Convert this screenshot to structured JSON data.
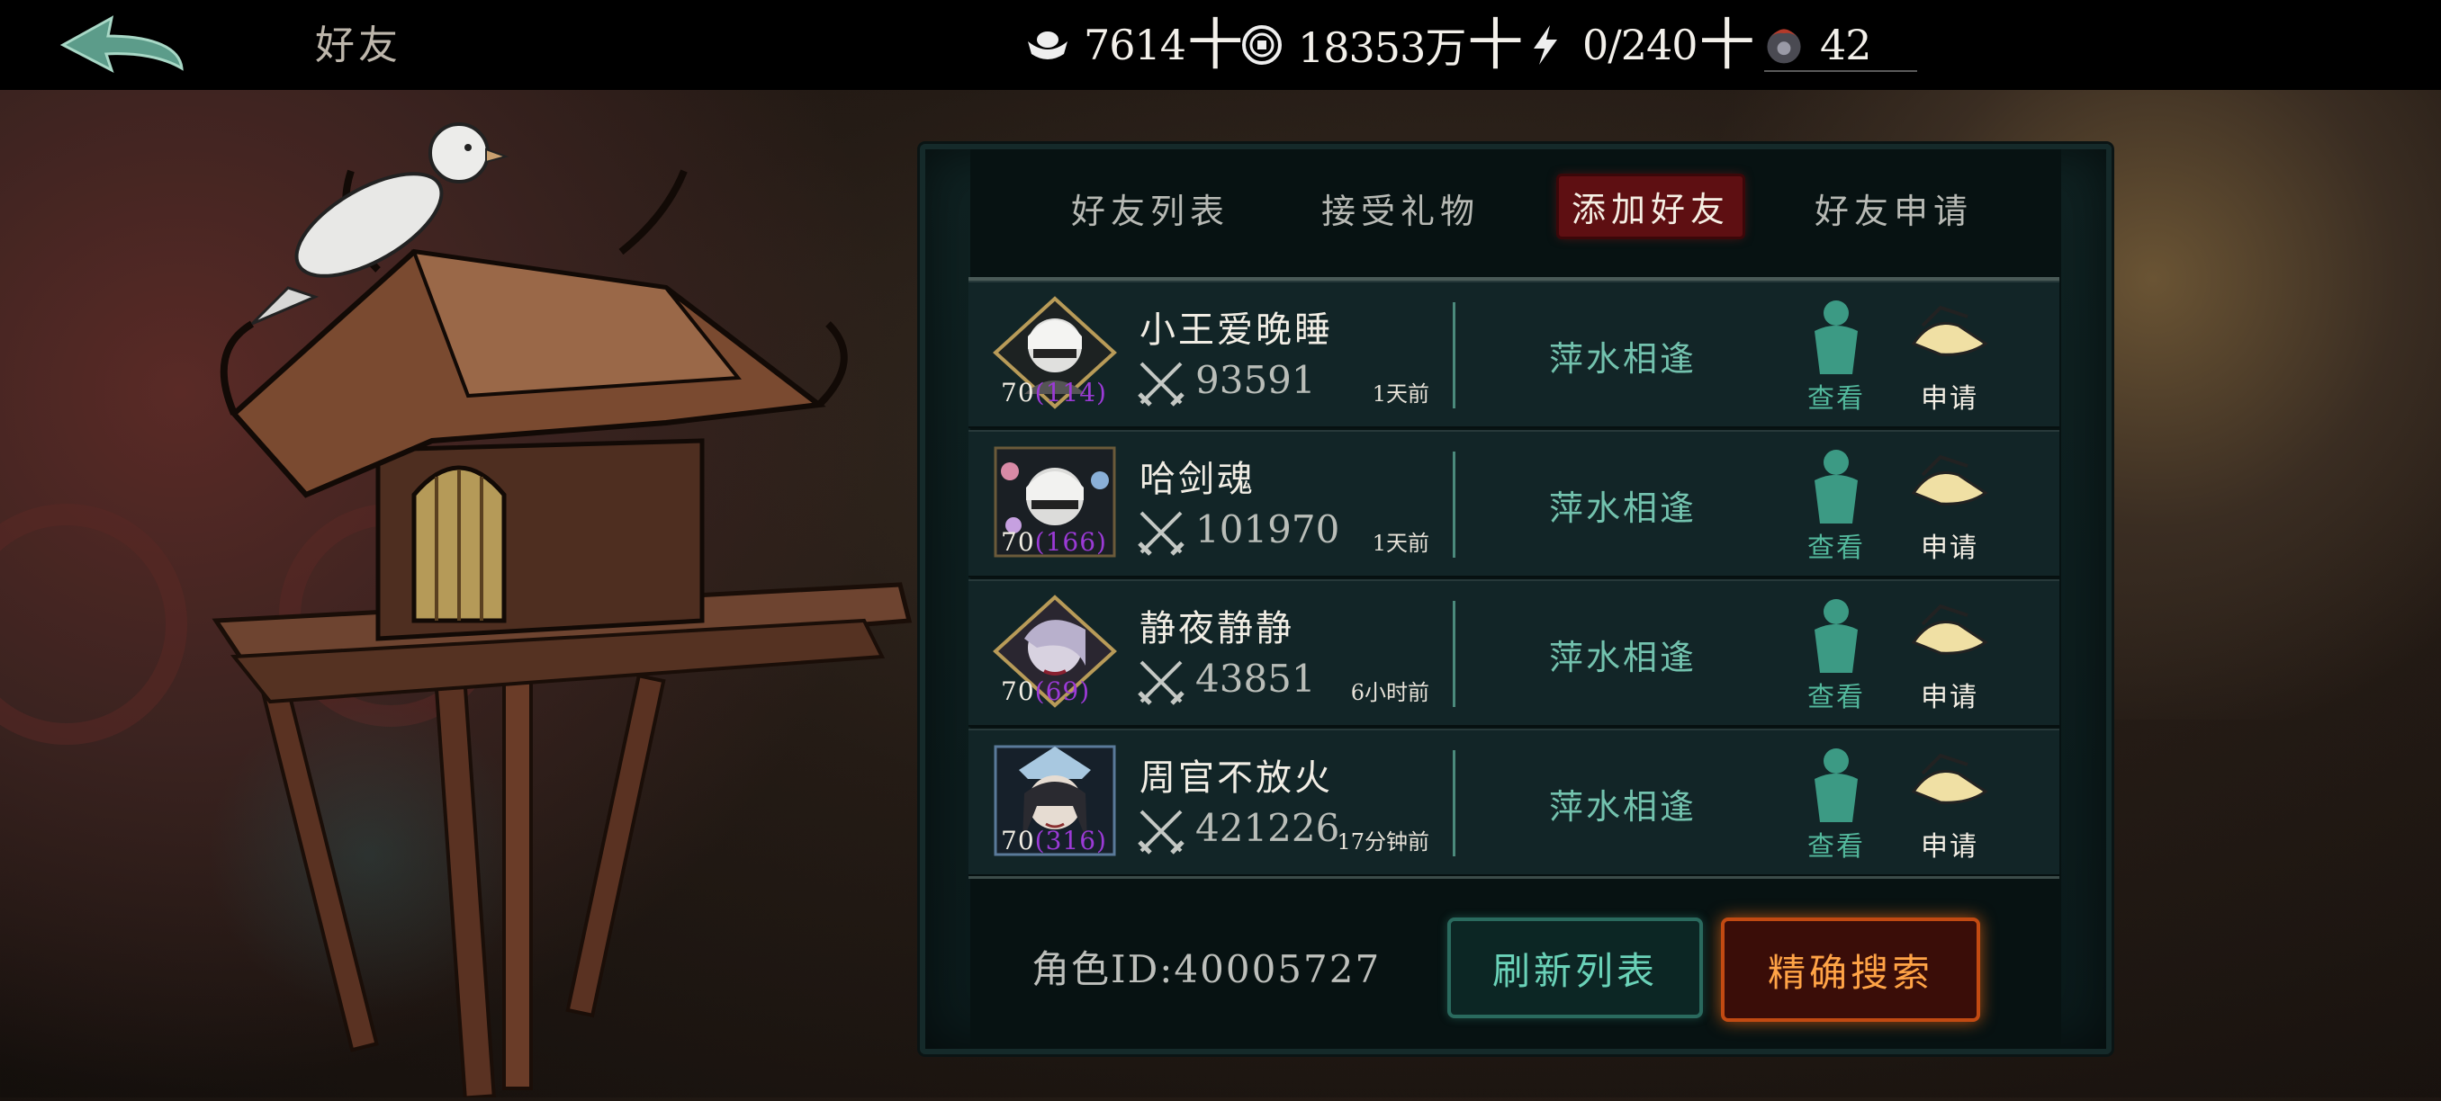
{
  "header": {
    "title": "好友",
    "resources": [
      {
        "icon": "silver-ingot-icon",
        "value": "7614",
        "plus": "十"
      },
      {
        "icon": "copper-coin-icon",
        "value": "18353万",
        "plus": "十"
      },
      {
        "icon": "lightning-icon",
        "value": "0/240",
        "plus": "十"
      },
      {
        "icon": "spirit-token-icon",
        "value": "42"
      }
    ]
  },
  "tabs": [
    {
      "label": "好友列表",
      "active": false
    },
    {
      "label": "接受礼物",
      "active": false
    },
    {
      "label": "添加好友",
      "active": true
    },
    {
      "label": "好友申请",
      "active": false
    }
  ],
  "rows": [
    {
      "name": "小王爱晚睡",
      "level": "70",
      "sublevel": "(114)",
      "power": "93591",
      "time": "1天前",
      "status": "萍水相逢",
      "view": "查看",
      "apply": "申请"
    },
    {
      "name": "哈剑魂",
      "level": "70",
      "sublevel": "(166)",
      "power": "101970",
      "time": "1天前",
      "status": "萍水相逢",
      "view": "查看",
      "apply": "申请"
    },
    {
      "name": "静夜静静",
      "level": "70",
      "sublevel": "(69)",
      "power": "43851",
      "time": "6小时前",
      "status": "萍水相逢",
      "view": "查看",
      "apply": "申请"
    },
    {
      "name": "周官不放火",
      "level": "70",
      "sublevel": "(316)",
      "power": "421226",
      "time": "17分钟前",
      "status": "萍水相逢",
      "view": "查看",
      "apply": "申请"
    }
  ],
  "footer": {
    "role_id": "角色ID:40005727",
    "refresh": "刷新列表",
    "search": "精确搜索"
  }
}
